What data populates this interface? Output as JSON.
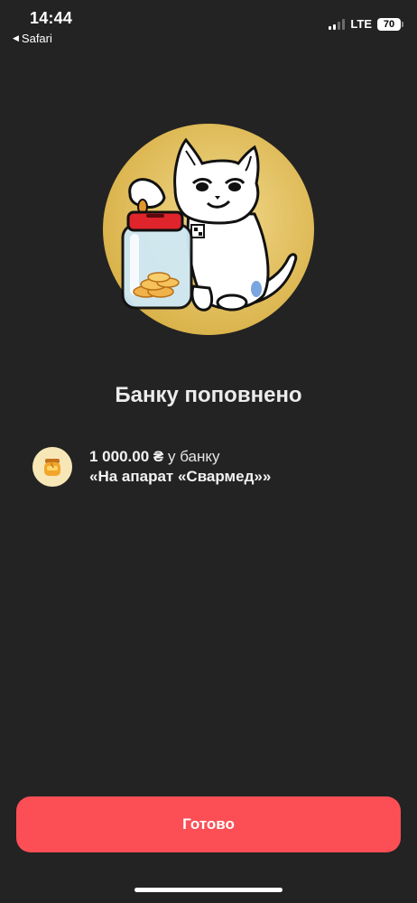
{
  "status_bar": {
    "time": "14:44",
    "back_app": "Safari",
    "network": "LTE",
    "battery_percent": "70",
    "signal_bars_active": 2,
    "signal_bars_total": 4
  },
  "hero": {
    "icon": "cat-with-coin-jar-illustration",
    "background_color": "#e0bd57"
  },
  "title": "Банку поповнено",
  "jar": {
    "icon": "honey-jar-icon",
    "amount": "1 000.00 ₴",
    "amount_suffix": "у банку",
    "name": "«На апарат «Свармед»»"
  },
  "done_button": {
    "label": "Готово",
    "color": "#fb4f55"
  },
  "colors": {
    "background": "#232323",
    "text": "#ececec",
    "accent": "#fb4f55"
  }
}
